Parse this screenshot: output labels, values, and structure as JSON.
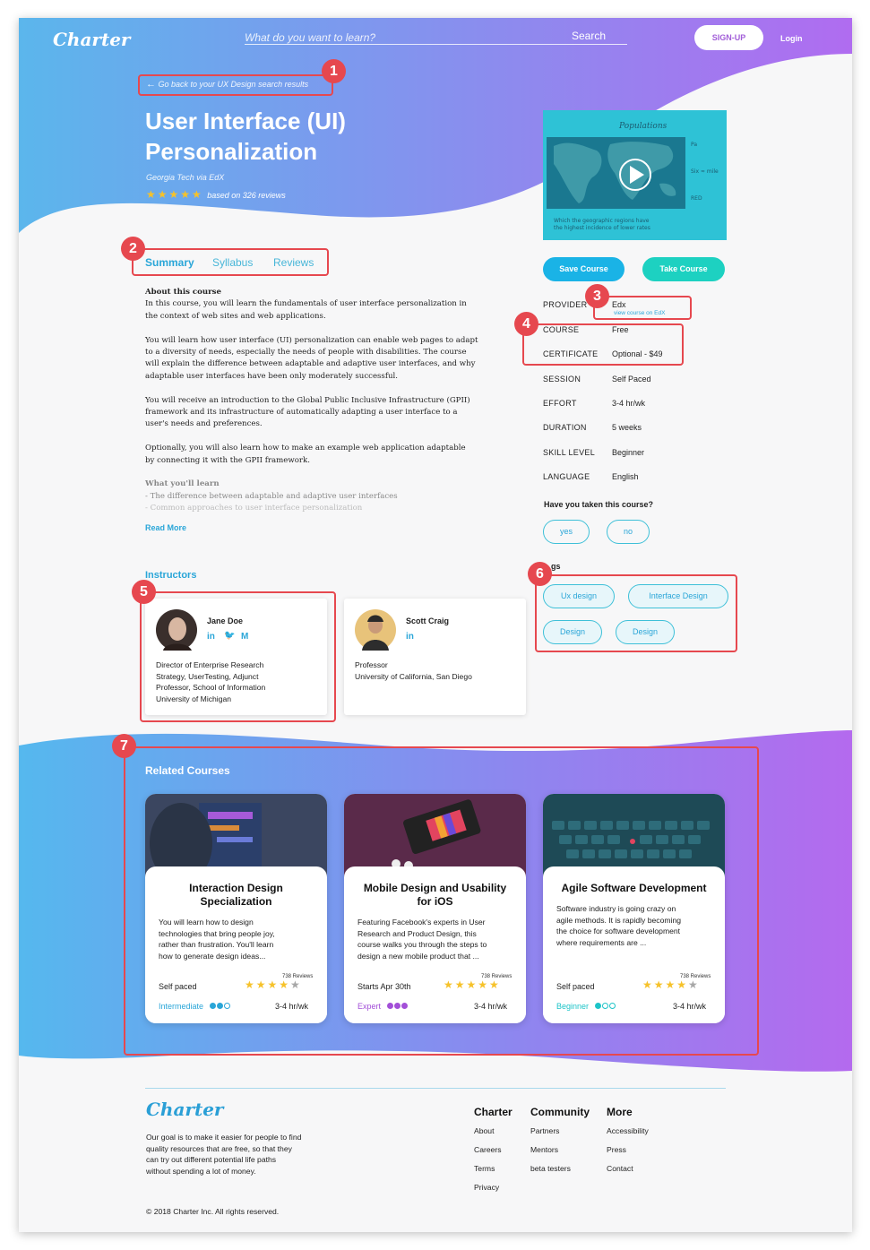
{
  "header": {
    "logo": "Charter",
    "search_placeholder": "What do you want to learn?",
    "search_button": "Search",
    "signup": "SIGN-UP",
    "login": "Login"
  },
  "hero": {
    "back_link": "Go back to your UX Design search results",
    "title_line1": "User Interface (UI)",
    "title_line2": "Personalization",
    "provider": "Georgia Tech via EdX",
    "reviews": "based on 326 reviews",
    "rating": 5
  },
  "tabs": [
    "Summary",
    "Syllabus",
    "Reviews"
  ],
  "summary": {
    "about_heading": "About this course",
    "p1": [
      "In this course, you will learn the fundamentals of user interface personalization in",
      "the context of web sites and web applications."
    ],
    "p2": [
      "You will learn how user interface (UI) personalization can enable web pages to adapt",
      "to a diversity of needs, especially the needs of people with disabilities. The course",
      "will explain the difference between adaptable and adaptive user interfaces, and why",
      "adaptable user interfaces have been only moderately successful."
    ],
    "p3": [
      "You will receive an introduction to the Global Public Inclusive Infrastructure (GPII)",
      "framework and its infrastructure of automatically adapting a user interface to a",
      "user's needs and preferences."
    ],
    "p4": [
      "Optionally, you will also learn how to make an example web application adaptable",
      "by connecting it with the GPII framework."
    ],
    "learn_heading": "What you'll learn",
    "learn1": "- The difference between adaptable and adaptive user interfaces",
    "learn2": "- Common approaches to user interface personalization",
    "read_more": "Read More"
  },
  "actions": {
    "save": "Save Course",
    "take": "Take Course"
  },
  "info": {
    "provider_label": "PROVIDER",
    "provider_value": "Edx",
    "provider_link": "view course on EdX",
    "course_label": "COURSE",
    "course_value": "Free",
    "certificate_label": "CERTIFICATE",
    "certificate_value": "Optional - $49",
    "session_label": "SESSION",
    "session_value": "Self Paced",
    "effort_label": "EFFORT",
    "effort_value": "3-4 hr/wk",
    "duration_label": "DURATION",
    "duration_value": "5 weeks",
    "skill_label": "SKILL LEVEL",
    "skill_value": "Beginner",
    "language_label": "LANGUAGE",
    "language_value": "English"
  },
  "taken": {
    "question": "Have you taken this course?",
    "yes": "yes",
    "no": "no"
  },
  "tags": {
    "heading_visible": "gs",
    "items": [
      "Ux design",
      "Interface Design",
      "Design",
      "Design"
    ]
  },
  "instructors": {
    "heading": "Instructors",
    "list": [
      {
        "name": "Jane Doe",
        "desc": [
          "Director of Enterprise Research",
          "Strategy, UserTesting, Adjunct",
          "Professor, School of Information",
          "University of Michigan"
        ],
        "socials": [
          "in",
          "…",
          "M"
        ]
      },
      {
        "name": "Scott Craig",
        "desc": [
          "Professor",
          "University of California, San Diego"
        ],
        "socials": [
          "in"
        ]
      }
    ]
  },
  "related": {
    "heading": "Related Courses",
    "courses": [
      {
        "title_line1": "Interaction Design",
        "title_line2": "Specialization",
        "desc": [
          "You will learn how to design",
          "technologies that bring people joy,",
          "rather than frustration. You'll learn",
          "how to generate design ideas..."
        ],
        "reviews": "738 Reviews",
        "pace": "Self paced",
        "level": "Intermediate",
        "level_color": "#2aa6d8",
        "effort": "3-4 hr/wk",
        "rating": 4
      },
      {
        "title_line1": "Mobile Design and Usability",
        "title_line2": "for iOS",
        "desc": [
          "Featuring Facebook's experts in User",
          "Research and Product Design, this",
          "course walks you through the steps to",
          "design a new mobile product that ..."
        ],
        "reviews": "738 Reviews",
        "pace": "Starts Apr 30th",
        "level": "Expert",
        "level_color": "#a34fd8",
        "effort": "3-4 hr/wk",
        "rating": 5
      },
      {
        "title_line1": "Agile Software Development",
        "title_line2": "",
        "desc": [
          "Software industry is going crazy on",
          "agile methods.  It is rapidly becoming",
          "the choice for software development",
          "where requirements are ..."
        ],
        "reviews": "738 Reviews",
        "pace": "Self paced",
        "level": "Beginner",
        "level_color": "#1dc4c8",
        "effort": "3-4 hr/wk",
        "rating": 4
      }
    ]
  },
  "footer": {
    "logo": "Charter",
    "about": [
      "Our goal is to make it easier for people to find",
      "quality resources that are free, so that they",
      "can try out different potential life paths",
      "without spending a lot of money."
    ],
    "copyright": "© 2018 Charter Inc. All rights reserved.",
    "columns": [
      {
        "heading": "Charter",
        "links": [
          "About",
          "Careers",
          "Terms",
          "Privacy"
        ]
      },
      {
        "heading": "Community",
        "links": [
          "Partners",
          "Mentors",
          "beta testers"
        ]
      },
      {
        "heading": "More",
        "links": [
          "Accessibility",
          "Press",
          "Contact"
        ]
      }
    ]
  },
  "annotations": [
    "1",
    "2",
    "3",
    "4",
    "5",
    "6",
    "7"
  ],
  "colors": {
    "gradient_start": "#5bb6ec",
    "gradient_end": "#b06cf0",
    "accent": "#2aa6d8",
    "annotation": "#e6484f"
  }
}
